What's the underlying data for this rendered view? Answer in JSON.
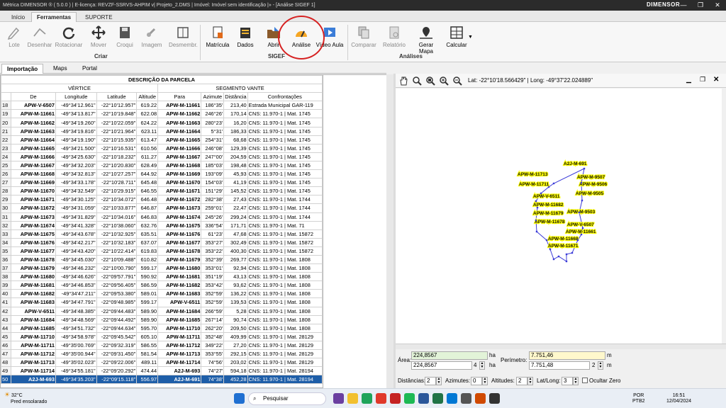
{
  "window": {
    "title": "Métrica DIMENSOR ® ( 5.0.0 ) | E-licença: REVZF-SSRVS-AHPIM v| Projeto_2.DMS | Imóvel: Imóvel sem identificação |» - [Análise SIGEF 1]",
    "brand": "DIMENSOR"
  },
  "tabs": [
    "Início",
    "Ferramentas",
    "SUPORTE"
  ],
  "ribbon": {
    "buttons": [
      "Lote",
      "Desenhar",
      "Rotacionar",
      "Mover",
      "Croqui",
      "Imagem",
      "Desmembr.",
      "Matrícula",
      "Dados",
      "Abrir",
      "Análise",
      "Vídeo Aula",
      "Comparar",
      "Relatório",
      "Gerar Mapa",
      "Calcular"
    ],
    "groups": [
      "Criar",
      "SIGEF",
      "Análises"
    ]
  },
  "subtabs": [
    "Importação",
    "Maps",
    "Portal"
  ],
  "table": {
    "caption": "DESCRIÇÃO DA PARCELA",
    "group_vertice": "VÉRTICE",
    "group_segmento": "SEGMENTO VANTE",
    "columns": [
      "De",
      "Longitude",
      "Latitude",
      "Altitude",
      "Para",
      "Azimute",
      "Distância",
      "Confrontações"
    ],
    "rows": [
      [
        "18",
        "APW-V-6507",
        "-49°34'12.961\"",
        "-22°10'12.957\"",
        "619.22",
        "APW-M-11661",
        "186°35'",
        "213,40",
        "Estrada Municipal GAR-119"
      ],
      [
        "19",
        "APW-M-11661",
        "-49°34'13.817\"",
        "-22°10'19.848\"",
        "622.08",
        "APW-M-11662",
        "246°26'",
        "170,14",
        "CNS: 11.970-1 | Mat. 1745"
      ],
      [
        "20",
        "APW-M-11662",
        "-49°34'19.260\"",
        "-22°10'22.059\"",
        "624.22",
        "APW-M-11663",
        "280°23'",
        "16,20",
        "CNS: 11.970-1 | Mat. 1745"
      ],
      [
        "21",
        "APW-M-11663",
        "-49°34'19.816\"",
        "-22°10'21.964\"",
        "623.11",
        "APW-M-11664",
        "5°31'",
        "186,33",
        "CNS: 11.970-1 | Mat. 1745"
      ],
      [
        "22",
        "APW-M-11664",
        "-49°34'19.190\"",
        "-22°10'15.935\"",
        "613.47",
        "APW-M-11665",
        "254°31'",
        "68,68",
        "CNS: 11.970-1 | Mat. 1745"
      ],
      [
        "23",
        "APW-M-11665",
        "-49°34'21.500\"",
        "-22°10'16.531\"",
        "610.56",
        "APW-M-11666",
        "246°08'",
        "129,39",
        "CNS: 11.970-1 | Mat. 1745"
      ],
      [
        "24",
        "APW-M-11666",
        "-49°34'25.630\"",
        "-22°10'18.232\"",
        "611.27",
        "APW-M-11667",
        "247°00'",
        "204,59",
        "CNS: 11.970-1 | Mat. 1745"
      ],
      [
        "25",
        "APW-M-11667",
        "-49°34'32.203\"",
        "-22°10'20.830\"",
        "628.49",
        "APW-M-11668",
        "185°03'",
        "198,48",
        "CNS: 11.970-1 | Mat. 1745"
      ],
      [
        "26",
        "APW-M-11668",
        "-49°34'32.813\"",
        "-22°10'27.257\"",
        "644.92",
        "APW-M-11669",
        "193°09'",
        "45,93",
        "CNS: 11.970-1 | Mat. 1745"
      ],
      [
        "27",
        "APW-M-11669",
        "-49°34'33.178\"",
        "-22°10'28.711\"",
        "645.48",
        "APW-M-11670",
        "154°03'",
        "41,19",
        "CNS: 11.970-1 | Mat. 1745"
      ],
      [
        "28",
        "APW-M-11670",
        "-49°34'32.549\"",
        "-22°10'29.915\"",
        "646.55",
        "APW-M-11671",
        "151°29'",
        "145,52",
        "CNS: 11.970-1 | Mat. 1745"
      ],
      [
        "29",
        "APW-M-11671",
        "-49°34'30.125\"",
        "-22°10'34.072\"",
        "646.48",
        "APW-M-11672",
        "282°38'",
        "27,43",
        "CNS: 11.970-1 | Mat. 1744"
      ],
      [
        "30",
        "APW-M-11672",
        "-49°34'31.059\"",
        "-22°10'33.877\"",
        "646.87",
        "APW-M-11673",
        "259°01'",
        "22,47",
        "CNS: 11.970-1 | Mat. 1744"
      ],
      [
        "31",
        "APW-M-11673",
        "-49°34'31.829\"",
        "-22°10'34.016\"",
        "646.83",
        "APW-M-11674",
        "245°26'",
        "299,24",
        "CNS: 11.970-1 | Mat. 1744"
      ],
      [
        "32",
        "APW-M-11674",
        "-49°34'41.328\"",
        "-22°10'38.060\"",
        "632.76",
        "APW-M-11675",
        "336°54'",
        "171,71",
        "CNS: 11.970-1 | Mat. 71"
      ],
      [
        "33",
        "APW-M-11675",
        "-49°34'43.678\"",
        "-22°10'32.925\"",
        "635.51",
        "APW-M-11676",
        "61°23'",
        "47,68",
        "CNS: 11.970-1 | Mat. 15872"
      ],
      [
        "34",
        "APW-M-11676",
        "-49°34'42.217\"",
        "-22°10'32.183\"",
        "637.07",
        "APW-M-11677",
        "353°27'",
        "302,49",
        "CNS: 11.970-1 | Mat. 15872"
      ],
      [
        "35",
        "APW-M-11677",
        "-49°34'43.420\"",
        "-22°10'22.414\"",
        "619.83",
        "APW-M-11678",
        "353°22'",
        "400,30",
        "CNS: 11.970-1 | Mat. 15872"
      ],
      [
        "36",
        "APW-M-11678",
        "-49°34'45.030\"",
        "-22°10'09.488\"",
        "610.82",
        "APW-M-11679",
        "352°39'",
        "269,77",
        "CNS: 11.970-1 | Mat. 1808"
      ],
      [
        "37",
        "APW-M-11679",
        "-49°34'46.232\"",
        "-22°10'00.790\"",
        "599.17",
        "APW-M-11680",
        "353°01'",
        "92,94",
        "CNS: 11.970-1 | Mat. 1808"
      ],
      [
        "38",
        "APW-M-11680",
        "-49°34'46.626\"",
        "-22°09'57.791\"",
        "590.92",
        "APW-M-11681",
        "351°19'",
        "43,13",
        "CNS: 11.970-1 | Mat. 1808"
      ],
      [
        "39",
        "APW-M-11681",
        "-49°34'46.853\"",
        "-22°09'56.405\"",
        "586.59",
        "APW-M-11682",
        "353°42'",
        "93,62",
        "CNS: 11.970-1 | Mat. 1808"
      ],
      [
        "40",
        "APW-M-11682",
        "-49°34'47.211\"",
        "-22°09'53.380\"",
        "589.01",
        "APW-M-11683",
        "352°59'",
        "136,22",
        "CNS: 11.970-1 | Mat. 1808"
      ],
      [
        "41",
        "APW-M-11683",
        "-49°34'47.791\"",
        "-22°09'48.985\"",
        "599.17",
        "APW-V-6511",
        "352°59'",
        "139,53",
        "CNS: 11.970-1 | Mat. 1808"
      ],
      [
        "42",
        "APW-V-6511",
        "-49°34'48.385\"",
        "-22°09'44.483\"",
        "589.90",
        "APW-M-11684",
        "266°59'",
        "5,28",
        "CNS: 11.970-1 | Mat. 1808"
      ],
      [
        "43",
        "APW-M-11684",
        "-49°34'48.569\"",
        "-22°09'44.492\"",
        "589.90",
        "APW-M-11685",
        "267°14'",
        "90,74",
        "CNS: 11.970-1 | Mat. 1808"
      ],
      [
        "44",
        "APW-M-11685",
        "-49°34'51.732\"",
        "-22°09'44.634\"",
        "595.70",
        "APW-M-11710",
        "262°20'",
        "209,50",
        "CNS: 11.970-1 | Mat. 1808"
      ],
      [
        "45",
        "APW-M-11710",
        "-49°34'58.978\"",
        "-22°09'45.542\"",
        "605.10",
        "APW-M-11711",
        "352°48'",
        "409,99",
        "CNS: 11.970-1 | Mat. 28129"
      ],
      [
        "46",
        "APW-M-11711",
        "-49°35'00.769\"",
        "-22°09'32.319\"",
        "586.55",
        "APW-M-11712",
        "349°22'",
        "27,20",
        "CNS: 11.970-1 | Mat. 28129"
      ],
      [
        "47",
        "APW-M-11712",
        "-49°35'00.944\"",
        "-22°09'31.450\"",
        "581.54",
        "APW-M-11713",
        "353°55'",
        "292,15",
        "CNS: 11.970-1 | Mat. 28129"
      ],
      [
        "48",
        "APW-M-11713",
        "-49°35'02.023\"",
        "-22°09'22.006\"",
        "489.11",
        "APW-M-11714",
        "74°56'",
        "203,02",
        "CNS: 11.970-1 | Mat. 28129"
      ],
      [
        "49",
        "APW-M-11714",
        "-49°34'55.181\"",
        "-22°09'20.292\"",
        "474.44",
        "A2J-M-693",
        "74°27'",
        "594,18",
        "CNS: 11.970-1 | Mat. 28194"
      ],
      [
        "50",
        "A2J-M-693",
        "-49°34'35.203\"",
        "-22°09'15.118\"",
        "556.97",
        "A2J-M-691",
        "74°38'",
        "452,28",
        "CNS: 11.970-1 | Mat. 28194"
      ]
    ]
  },
  "map": {
    "lat": "Lat: -22°10'18.566429\"",
    "long": "Long: -49°37'22.024889\"",
    "sep": "|",
    "labels": [
      "A2J-M-691",
      "APW-M-11713",
      "APW-M-9507",
      "APW-M-11711",
      "APW-M-9506",
      "APW-M-9505",
      "APW-V-6511",
      "APW-M-11682",
      "APW-M-9503",
      "APW-M-11679",
      "APW-M-11678",
      "APW-V-6507",
      "APW-M-11661",
      "APW-M-11668",
      "APW-M-11671"
    ]
  },
  "measures": {
    "area_label": "Área:",
    "area_value_1": "224,8567",
    "area_value_2": "224,8567",
    "area_unit": "ha",
    "area_decimals": "4",
    "perimeter_label": "Perímetro:",
    "perimeter_value_1": "7.751,46",
    "perimeter_value_2": "7.751,48",
    "perimeter_unit": "m",
    "perimeter_decimals": "2"
  },
  "status": {
    "distancias_label": "Distâncias:",
    "distancias_value": "2",
    "azimutes_label": "Azimutes:",
    "azimutes_value": "0",
    "altitudes_label": "Altitudes:",
    "altitudes_value": "2",
    "latlong_label": "Lat/Long:",
    "latlong_value": "3",
    "ocultar_zero": "Ocultar Zero"
  },
  "taskbar": {
    "temperature": "32°C",
    "weather": "Pred ensolarado",
    "search_placeholder": "Pesquisar",
    "lang_1": "POR",
    "lang_2": "PTB2",
    "time": "16:51",
    "date": "12/04/2024"
  },
  "colors": {
    "accent": "#1e5ea8",
    "highlight_circle": "#d62222",
    "map_label": "#ffff00"
  }
}
